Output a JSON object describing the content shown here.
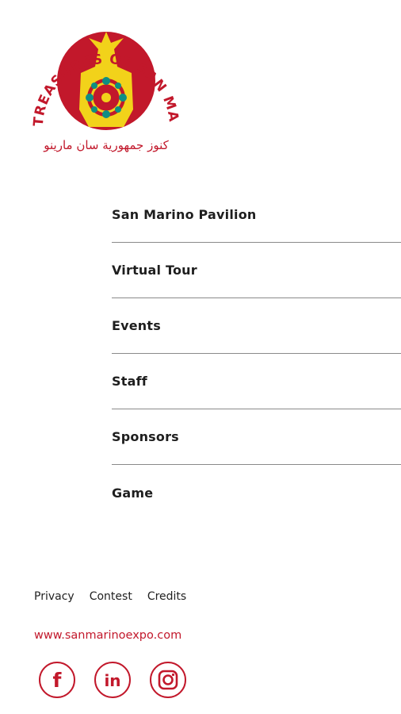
{
  "brand": {
    "logo_text": "THE TREASURES OF SAN MARINO",
    "logo_arabic": "كنوز جمهورية سان مارينو",
    "colors": {
      "red": "#c2182b",
      "yellow": "#f2d21a",
      "teal": "#0f8e83"
    }
  },
  "menu": {
    "items": [
      {
        "label": "San Marino Pavilion"
      },
      {
        "label": "Virtual Tour"
      },
      {
        "label": "Events"
      },
      {
        "label": "Staff"
      },
      {
        "label": "Sponsors"
      },
      {
        "label": "Game"
      }
    ]
  },
  "footer": {
    "links": [
      {
        "label": "Privacy"
      },
      {
        "label": "Contest"
      },
      {
        "label": "Credits"
      }
    ],
    "website": "www.sanmarinoexpo.com",
    "social": [
      {
        "icon": "facebook-icon",
        "glyph": "f"
      },
      {
        "icon": "linkedin-icon",
        "glyph": "in"
      },
      {
        "icon": "instagram-icon"
      }
    ]
  }
}
